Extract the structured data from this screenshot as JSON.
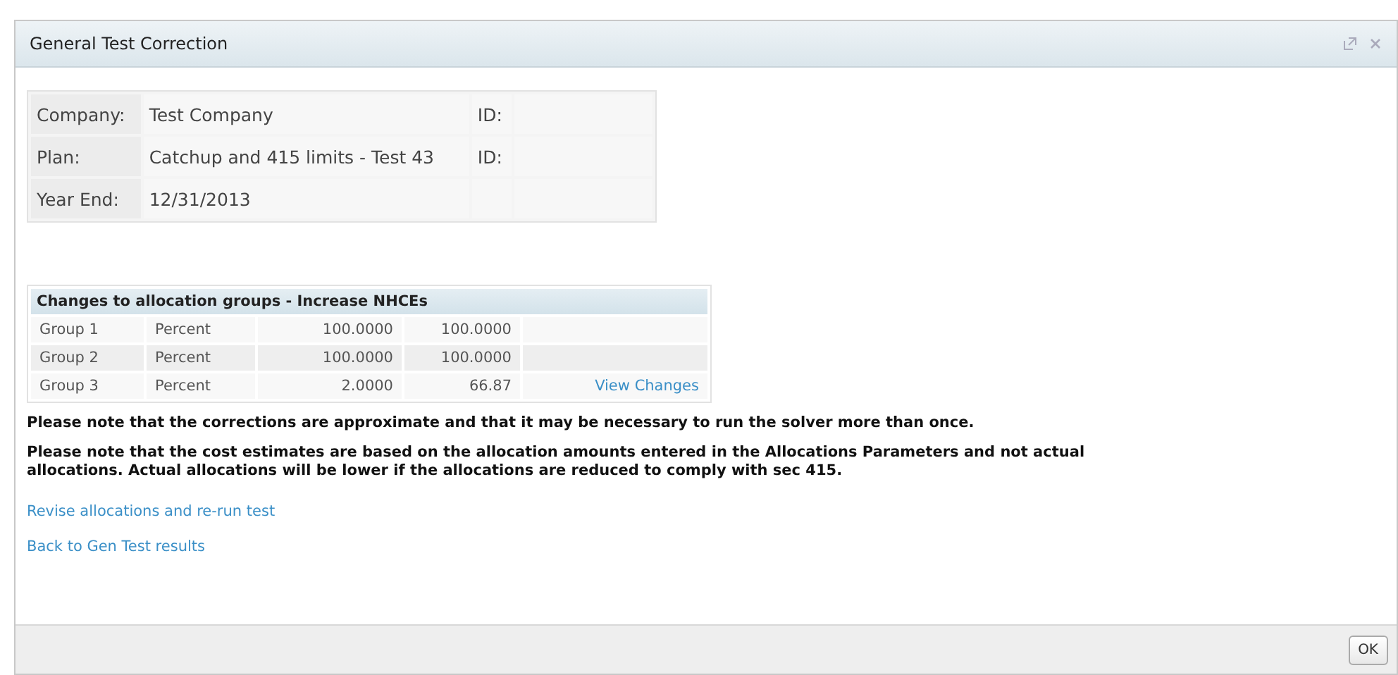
{
  "window": {
    "title": "General Test Correction"
  },
  "info": [
    {
      "label": "Company:",
      "value": "Test Company",
      "id_label": "ID:"
    },
    {
      "label": "Plan:",
      "value": "Catchup and 415 limits - Test 43",
      "id_label": "ID:"
    },
    {
      "label": "Year End:",
      "value": "12/31/2013"
    }
  ],
  "allocation_table": {
    "title": "Changes to allocation groups - Increase NHCEs",
    "rows": [
      {
        "group": "Group 1",
        "type": "Percent",
        "value_1": "100.0000",
        "value_2": "100.0000"
      },
      {
        "group": "Group 2",
        "type": "Percent",
        "value_1": "100.0000",
        "value_2": "100.0000"
      },
      {
        "group": "Group 3",
        "type": "Percent",
        "value_1": "2.0000",
        "value_2": "66.87",
        "link": "View Changes"
      }
    ]
  },
  "notes": [
    "Please note that the corrections are approximate and that it may be necessary to run the solver more than once.",
    "Please note that the cost estimates are based on the allocation amounts entered in the Allocations Parameters and not actual allocations. Actual allocations will be lower if the allocations are reduced to comply with sec 415."
  ],
  "links": [
    "Revise allocations and re-run test",
    "Back to Gen Test results"
  ],
  "buttons": [
    "OK"
  ]
}
